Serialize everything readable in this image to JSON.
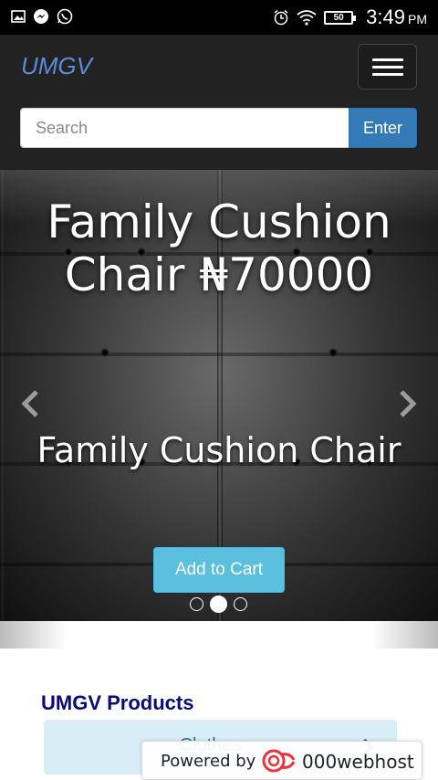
{
  "status_bar": {
    "time": "3:49",
    "ampm": "PM",
    "battery": "50",
    "icons": [
      "image-icon",
      "messenger-icon",
      "whatsapp-icon",
      "alarm-icon",
      "wifi-icon",
      "battery-icon"
    ]
  },
  "navbar": {
    "brand": "UMGV",
    "menu_icon": "hamburger-icon"
  },
  "search": {
    "placeholder": "Search",
    "button_label": "Enter"
  },
  "carousel": {
    "slide_title": "Family Cushion Chair ₦70000",
    "slide_caption": "Family Cushion Chair",
    "cart_button": "Add to Cart",
    "prev_icon": "chevron-left-icon",
    "next_icon": "chevron-right-icon",
    "indicators": 3,
    "active_indicator": 2
  },
  "products": {
    "heading": "UMGV Products",
    "categories": [
      {
        "label": "Clothes"
      }
    ]
  },
  "webhost_badge": {
    "powered": "Powered by",
    "name": "000webhost"
  },
  "colors": {
    "navbar_bg": "#222222",
    "brand": "#5b8bd9",
    "enter_button": "#337ab7",
    "cart_button": "#5bc0de",
    "heading": "#0a0a7a",
    "category_bg": "#d9edf7"
  }
}
